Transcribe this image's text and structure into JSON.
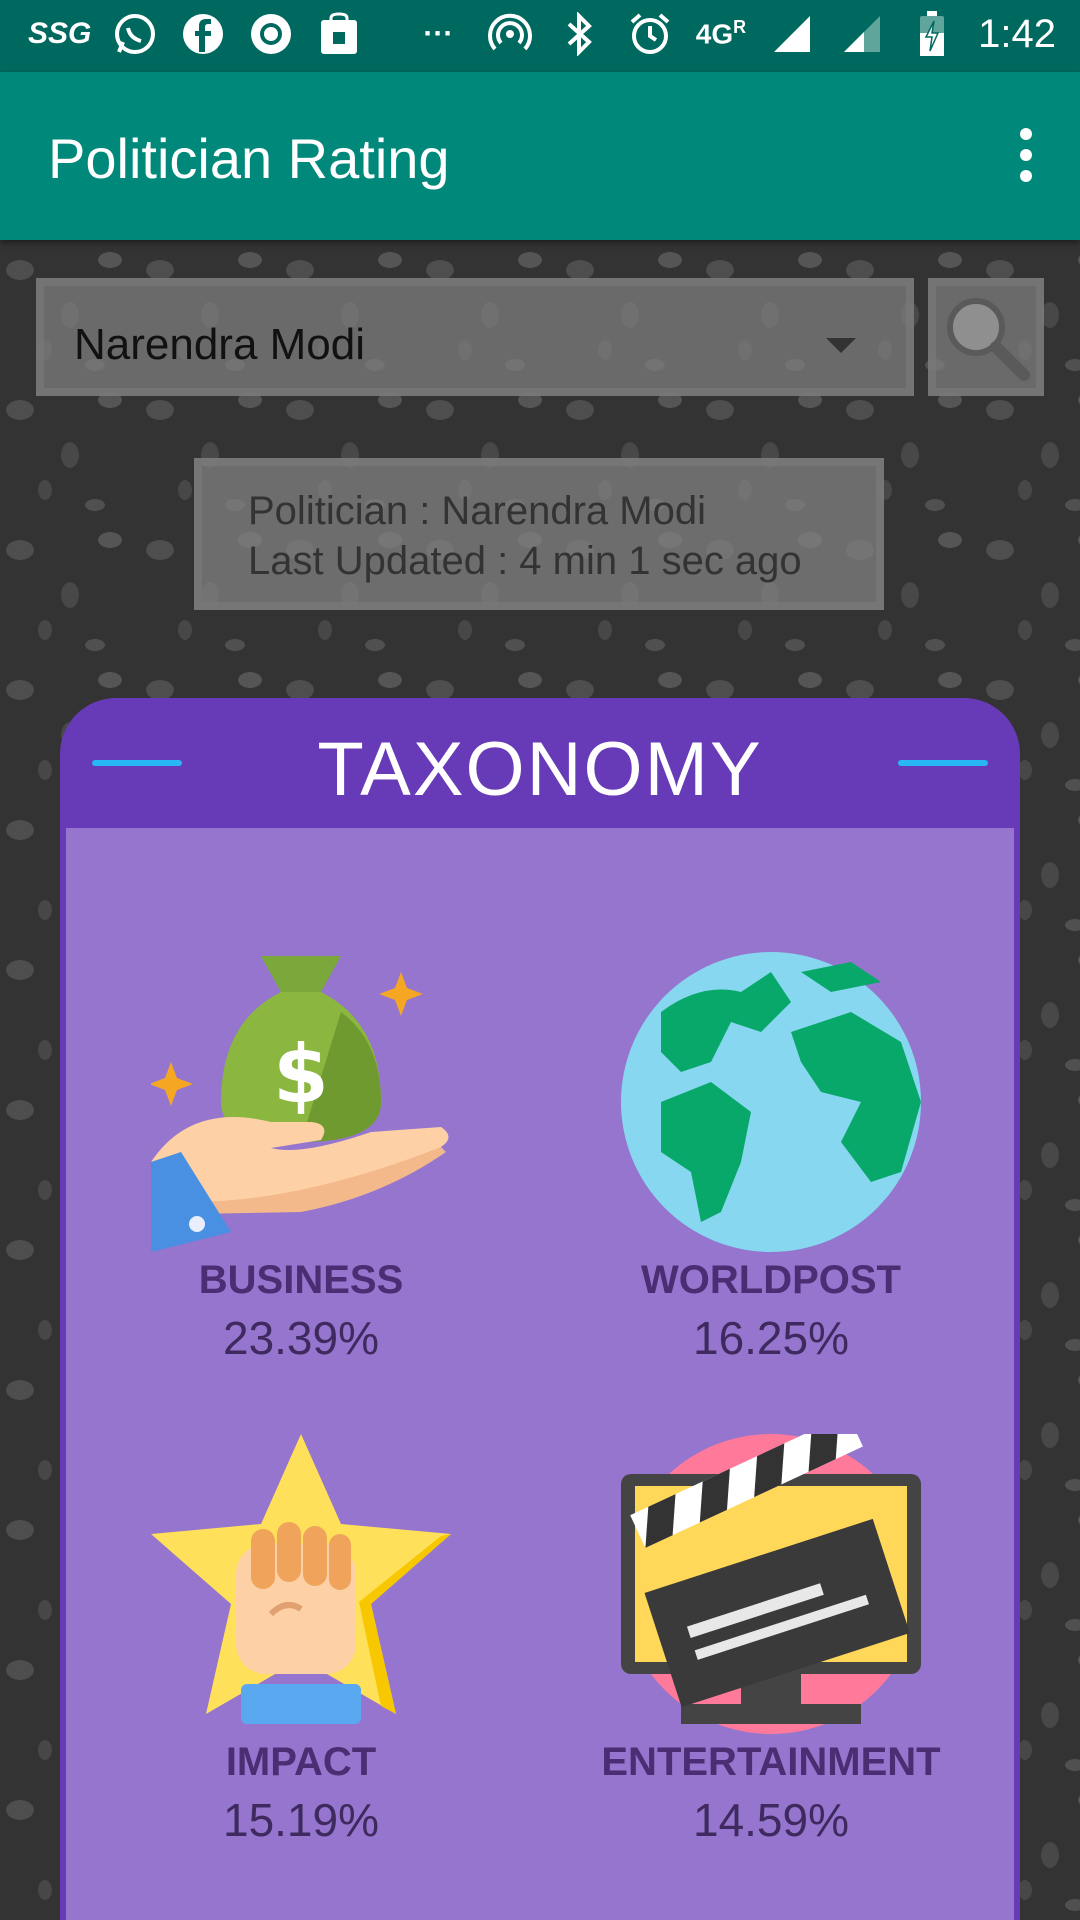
{
  "status_bar": {
    "carrier_label": "SSG",
    "network": "4G",
    "roaming": "R",
    "time": "1:42",
    "more": "···"
  },
  "app_bar": {
    "title": "Politician Rating"
  },
  "selector": {
    "selected": "Narendra Modi"
  },
  "info": {
    "politician_line": "Politician : Narendra Modi",
    "updated_line": "Last Updated : 4 min 1 sec ago"
  },
  "taxonomy": {
    "title": "TAXONOMY",
    "categories": [
      {
        "label": "BUSINESS",
        "percent": "23.39%",
        "icon": "money-bag-hand-icon"
      },
      {
        "label": "WORLDPOST",
        "percent": "16.25%",
        "icon": "globe-icon"
      },
      {
        "label": "IMPACT",
        "percent": "15.19%",
        "icon": "fist-star-icon"
      },
      {
        "label": "ENTERTAINMENT",
        "percent": "14.59%",
        "icon": "clapperboard-icon"
      }
    ]
  },
  "colors": {
    "status_bar": "#00695f",
    "app_bar": "#00897b",
    "card_header": "#673ab7",
    "card_body": "#9575cd",
    "accent_line": "#29b6f6"
  }
}
